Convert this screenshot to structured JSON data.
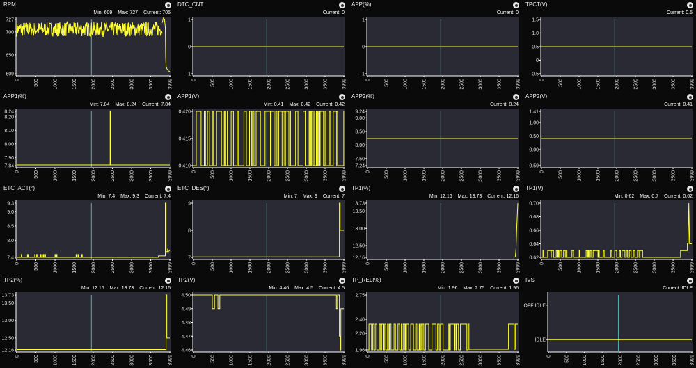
{
  "colors": {
    "background": "#2a2a35",
    "trace": "#ffff33",
    "cursor": "#4fb3b3",
    "axis": "#ffffff",
    "text": "#f0f0f0"
  },
  "icons": {
    "panel_button": "target-circle-icon"
  },
  "x_ticks": [
    "0",
    "500",
    "1000",
    "1500",
    "2000",
    "2500",
    "3000",
    "3500",
    "3999"
  ],
  "panels": [
    {
      "id": "rpm",
      "title": "RPM",
      "stats": [
        "Min: 609",
        "Max: 727",
        "Current: 705"
      ],
      "chart_data": {
        "type": "line",
        "ylim": [
          609,
          727
        ],
        "yticks": [
          "727",
          "700",
          "650",
          "609"
        ],
        "ytick_values": [
          727,
          700,
          650,
          609
        ],
        "cursor_x": 1950,
        "segments": [
          {
            "kind": "noise",
            "x0": 0,
            "x1": 3800,
            "lo": 690,
            "hi": 722
          },
          {
            "kind": "points",
            "pts": [
              [
                3800,
                720
              ],
              [
                3830,
                730
              ],
              [
                3860,
                727
              ],
              [
                3880,
                710
              ],
              [
                3890,
                645
              ],
              [
                3900,
                625
              ],
              [
                3920,
                620
              ],
              [
                3940,
                618
              ],
              [
                3960,
                615
              ],
              [
                3999,
                614
              ]
            ]
          }
        ]
      }
    },
    {
      "id": "dtc_cnt",
      "title": "DTC_CNT",
      "stats": [
        "Current: 0"
      ],
      "chart_data": {
        "type": "line",
        "ylim": [
          -1,
          1
        ],
        "yticks": [
          "1",
          "0",
          "-1"
        ],
        "ytick_values": [
          1,
          0,
          -1
        ],
        "cursor_x": 1950,
        "segments": [
          {
            "kind": "points",
            "pts": [
              [
                0,
                0
              ],
              [
                3999,
                0
              ]
            ]
          }
        ]
      }
    },
    {
      "id": "app",
      "title": "APP(%)",
      "stats": [
        "Current: 0"
      ],
      "chart_data": {
        "type": "line",
        "ylim": [
          -1,
          1
        ],
        "yticks": [
          "1",
          "0",
          "-1"
        ],
        "ytick_values": [
          1,
          0,
          -1
        ],
        "cursor_x": 1950,
        "segments": [
          {
            "kind": "points",
            "pts": [
              [
                0,
                0
              ],
              [
                3999,
                0
              ]
            ]
          }
        ]
      }
    },
    {
      "id": "tpct",
      "title": "TPCT(V)",
      "stats": [
        "Current: 0.5"
      ],
      "chart_data": {
        "type": "line",
        "ylim": [
          -0.5,
          1.5
        ],
        "yticks": [
          "1.5",
          "1.0",
          "0.5",
          "0",
          "-0.5"
        ],
        "ytick_values": [
          1.5,
          1.0,
          0.5,
          0,
          -0.5
        ],
        "cursor_x": 1950,
        "segments": [
          {
            "kind": "points",
            "pts": [
              [
                0,
                0.5
              ],
              [
                3999,
                0.5
              ]
            ]
          }
        ]
      }
    },
    {
      "id": "app1_pct",
      "title": "APP1(%)",
      "stats": [
        "Min: 7.84",
        "Max: 8.24",
        "Current: 7.84"
      ],
      "chart_data": {
        "type": "line",
        "ylim": [
          7.84,
          8.24
        ],
        "yticks": [
          "8.24",
          "8.20",
          "8.10",
          "8.00",
          "7.90",
          "7.84"
        ],
        "ytick_values": [
          8.24,
          8.2,
          8.1,
          8.0,
          7.9,
          7.84
        ],
        "cursor_x": 1950,
        "segments": [
          {
            "kind": "points",
            "pts": [
              [
                0,
                7.845
              ],
              [
                2440,
                7.845
              ],
              [
                2440,
                8.24
              ],
              [
                2450,
                8.24
              ],
              [
                2450,
                7.845
              ],
              [
                3999,
                7.845
              ]
            ]
          }
        ]
      }
    },
    {
      "id": "app1_v",
      "title": "APP1(V)",
      "stats": [
        "Min: 0.41",
        "Max: 0.42",
        "Current: 0.42"
      ],
      "chart_data": {
        "type": "line",
        "ylim": [
          0.41,
          0.42
        ],
        "yticks": [
          "0.420",
          "0.415",
          "0.410"
        ],
        "ytick_values": [
          0.42,
          0.415,
          0.41
        ],
        "cursor_x": 1950,
        "segments": [
          {
            "kind": "binary",
            "x0": 0,
            "x1": 3999,
            "lo": 0.41,
            "hi": 0.42
          }
        ]
      }
    },
    {
      "id": "app2_pct",
      "title": "APP2(%)",
      "stats": [
        "Current: 8.24"
      ],
      "chart_data": {
        "type": "line",
        "ylim": [
          7.24,
          9.24
        ],
        "yticks": [
          "9.24",
          "9.00",
          "8.50",
          "8.00",
          "7.50",
          "7.24"
        ],
        "ytick_values": [
          9.24,
          9.0,
          8.5,
          8.0,
          7.5,
          7.24
        ],
        "cursor_x": 1950,
        "segments": [
          {
            "kind": "points",
            "pts": [
              [
                0,
                8.24
              ],
              [
                3999,
                8.24
              ]
            ]
          }
        ]
      }
    },
    {
      "id": "app2_v",
      "title": "APP2(V)",
      "stats": [
        "Current: 0.41"
      ],
      "chart_data": {
        "type": "line",
        "ylim": [
          -0.59,
          1.41
        ],
        "yticks": [
          "1.41",
          "1.00",
          "0.50",
          "0.00",
          "-0.59"
        ],
        "ytick_values": [
          1.41,
          1.0,
          0.5,
          0.0,
          -0.59
        ],
        "cursor_x": 1950,
        "segments": [
          {
            "kind": "points",
            "pts": [
              [
                0,
                0.41
              ],
              [
                3999,
                0.41
              ]
            ]
          }
        ]
      }
    },
    {
      "id": "etc_act",
      "title": "ETC_ACT(°)",
      "stats": [
        "Min: 7.4",
        "Max: 9.3",
        "Current: 7.4"
      ],
      "chart_data": {
        "type": "line",
        "ylim": [
          7.4,
          9.3
        ],
        "yticks": [
          "9.3",
          "9.0",
          "8.5",
          "8.0",
          "7.4"
        ],
        "ytick_values": [
          9.3,
          9.0,
          8.5,
          8.0,
          7.4
        ],
        "cursor_x": 1950,
        "segments": [
          {
            "kind": "pulses",
            "base": 7.4,
            "peak": 7.5,
            "xs": [
              120,
              280,
              300,
              470,
              520,
              620,
              660,
              700,
              740,
              1000,
              1040,
              1550,
              1600,
              1700
            ]
          },
          {
            "kind": "points",
            "pts": [
              [
                3700,
                7.4
              ],
              [
                3700,
                7.45
              ],
              [
                3880,
                7.45
              ],
              [
                3880,
                9.3
              ],
              [
                3900,
                9.3
              ],
              [
                3900,
                7.6
              ],
              [
                3940,
                7.6
              ],
              [
                3940,
                7.7
              ],
              [
                3960,
                7.6
              ],
              [
                3999,
                7.65
              ]
            ]
          }
        ]
      }
    },
    {
      "id": "etc_des",
      "title": "ETC_DES(°)",
      "stats": [
        "Min: 7",
        "Max: 9",
        "Current: 7"
      ],
      "chart_data": {
        "type": "line",
        "ylim": [
          7,
          9
        ],
        "yticks": [
          "9",
          "8",
          "7"
        ],
        "ytick_values": [
          9,
          8,
          7
        ],
        "cursor_x": 1950,
        "segments": [
          {
            "kind": "points",
            "pts": [
              [
                0,
                7.02
              ],
              [
                3880,
                7.02
              ],
              [
                3880,
                9
              ],
              [
                3900,
                9
              ],
              [
                3900,
                8
              ],
              [
                3999,
                8
              ]
            ]
          }
        ]
      }
    },
    {
      "id": "tp1_pct",
      "title": "TP1(%)",
      "stats": [
        "Min: 12.16",
        "Max: 13.73",
        "Current: 12.16"
      ],
      "chart_data": {
        "type": "line",
        "ylim": [
          12.16,
          13.73
        ],
        "yticks": [
          "13.73",
          "13.50",
          "13.00",
          "12.50",
          "12.16"
        ],
        "ytick_values": [
          13.73,
          13.5,
          13.0,
          12.5,
          12.16
        ],
        "cursor_x": 1950,
        "segments": [
          {
            "kind": "points",
            "pts": [
              [
                0,
                12.17
              ],
              [
                3930,
                12.17
              ],
              [
                3950,
                12.4
              ],
              [
                3970,
                13.0
              ],
              [
                3999,
                13.73
              ]
            ]
          }
        ]
      }
    },
    {
      "id": "tp1_v",
      "title": "TP1(V)",
      "stats": [
        "Min: 0.62",
        "Max: 0.7",
        "Current: 0.62"
      ],
      "chart_data": {
        "type": "line",
        "ylim": [
          0.62,
          0.7
        ],
        "yticks": [
          "0.70",
          "0.68",
          "0.66",
          "0.64",
          "0.62"
        ],
        "ytick_values": [
          0.7,
          0.68,
          0.66,
          0.64,
          0.62
        ],
        "cursor_x": 1950,
        "segments": [
          {
            "kind": "binary",
            "x0": 0,
            "x1": 2900,
            "lo": 0.62,
            "hi": 0.63
          },
          {
            "kind": "points",
            "pts": [
              [
                2900,
                0.62
              ],
              [
                3700,
                0.62
              ],
              [
                3700,
                0.63
              ],
              [
                3880,
                0.63
              ],
              [
                3880,
                0.64
              ],
              [
                3900,
                0.64
              ],
              [
                3920,
                0.7
              ],
              [
                3940,
                0.64
              ],
              [
                3999,
                0.64
              ]
            ]
          }
        ]
      }
    },
    {
      "id": "tp2_pct",
      "title": "TP2(%)",
      "stats": [
        "Min: 12.16",
        "Max: 13.73",
        "Current: 12.16"
      ],
      "chart_data": {
        "type": "line",
        "ylim": [
          12.16,
          13.73
        ],
        "yticks": [
          "13.73",
          "13.50",
          "13.00",
          "12.50",
          "12.16"
        ],
        "ytick_values": [
          13.73,
          13.5,
          13.0,
          12.5,
          12.16
        ],
        "cursor_x": 1950,
        "segments": [
          {
            "kind": "points",
            "pts": [
              [
                0,
                12.17
              ],
              [
                3900,
                12.17
              ],
              [
                3900,
                13.73
              ],
              [
                3920,
                13.73
              ],
              [
                3920,
                12.5
              ],
              [
                3999,
                12.5
              ]
            ]
          }
        ]
      }
    },
    {
      "id": "tp2_v",
      "title": "TP2(V)",
      "stats": [
        "Min: 4.46",
        "Max: 4.5",
        "Current: 4.5"
      ],
      "chart_data": {
        "type": "line",
        "ylim": [
          4.46,
          4.5
        ],
        "yticks": [
          "4.50",
          "4.49",
          "4.48",
          "4.47",
          "4.46"
        ],
        "ytick_values": [
          4.5,
          4.49,
          4.48,
          4.47,
          4.46
        ],
        "cursor_x": 1950,
        "segments": [
          {
            "kind": "points",
            "pts": [
              [
                0,
                4.5
              ],
              [
                500,
                4.5
              ],
              [
                500,
                4.49
              ],
              [
                560,
                4.49
              ],
              [
                560,
                4.5
              ],
              [
                650,
                4.5
              ],
              [
                650,
                4.49
              ],
              [
                700,
                4.49
              ],
              [
                700,
                4.5
              ],
              [
                3800,
                4.5
              ],
              [
                3800,
                4.49
              ],
              [
                3830,
                4.49
              ],
              [
                3830,
                4.5
              ],
              [
                3880,
                4.5
              ],
              [
                3880,
                4.47
              ],
              [
                3900,
                4.47
              ],
              [
                3900,
                4.46
              ],
              [
                3920,
                4.46
              ],
              [
                3920,
                4.49
              ],
              [
                3999,
                4.49
              ]
            ]
          }
        ]
      }
    },
    {
      "id": "tp_rel",
      "title": "TP_REL(%)",
      "stats": [
        "Min: 1.96",
        "Max: 2.75",
        "Current: 1.96"
      ],
      "chart_data": {
        "type": "line",
        "ylim": [
          1.96,
          2.75
        ],
        "yticks": [
          "2.75",
          "2.40",
          "2.20",
          "1.96"
        ],
        "ytick_values": [
          2.75,
          2.4,
          2.2,
          1.96
        ],
        "cursor_x": 1950,
        "segments": [
          {
            "kind": "binary",
            "x0": 0,
            "x1": 2700,
            "lo": 1.96,
            "hi": 2.33
          },
          {
            "kind": "points",
            "pts": [
              [
                2700,
                1.97
              ],
              [
                3750,
                1.97
              ],
              [
                3750,
                2.33
              ],
              [
                3900,
                2.33
              ],
              [
                3900,
                1.97
              ],
              [
                3930,
                1.97
              ],
              [
                3930,
                2.33
              ],
              [
                3999,
                2.33
              ]
            ]
          }
        ]
      }
    },
    {
      "id": "ivs",
      "title": "IVS",
      "stats": [
        "Current: IDLE"
      ],
      "chart_data": {
        "type": "line",
        "ylim": [
          0,
          1
        ],
        "yticks": [
          "OFF IDLE",
          "IDLE"
        ],
        "ytick_values": [
          1,
          0
        ],
        "yrange_pad": [
          0.3,
          0.3
        ],
        "cursor_x": 1950,
        "segments": [
          {
            "kind": "points",
            "pts": [
              [
                0,
                0
              ],
              [
                3999,
                0
              ]
            ]
          }
        ]
      }
    }
  ]
}
